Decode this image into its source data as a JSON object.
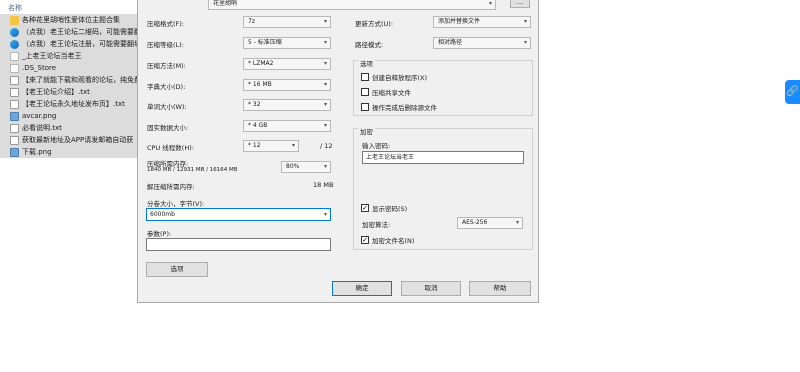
{
  "explorer": {
    "column_header": "名称",
    "items": [
      {
        "name": "各种花里胡哨性爱体位主题合集",
        "icon": "folder-icon",
        "selected": true
      },
      {
        "name": "（点我）老王论坛二维码，可能需要翻",
        "icon": "edge-icon",
        "selected": true
      },
      {
        "name": "（点我）老王论坛注册，可能需要翻墙",
        "icon": "edge-icon",
        "selected": true
      },
      {
        "name": "_上老王论坛当老王",
        "icon": "file-icon",
        "selected": true
      },
      {
        "name": ".DS_Store",
        "icon": "file-icon",
        "selected": true
      },
      {
        "name": "【来了就能下载和观看的论坛，纯免费",
        "icon": "text-file-icon",
        "selected": true
      },
      {
        "name": "【老王论坛介绍】.txt",
        "icon": "text-file-icon",
        "selected": true
      },
      {
        "name": "【老王论坛永久地址发布页】.txt",
        "icon": "text-file-icon",
        "selected": true
      },
      {
        "name": "avcar.png",
        "icon": "image-icon",
        "selected": true
      },
      {
        "name": "必看说明.txt",
        "icon": "text-file-icon",
        "selected": true
      },
      {
        "name": "获取最新地址及APP请发邮箱自动获",
        "icon": "text-file-icon",
        "selected": true
      },
      {
        "name": "下载.png",
        "icon": "image-icon",
        "selected": true
      }
    ]
  },
  "dialog": {
    "archive_path": "花里胡哨",
    "browse_label": "...",
    "format": {
      "label": "压缩格式(F):",
      "value": "7z"
    },
    "level": {
      "label": "压缩等级(L):",
      "value": "5 - 标准压缩"
    },
    "method": {
      "label": "压缩方法(M):",
      "value": "* LZMA2"
    },
    "dict": {
      "label": "字典大小(D):",
      "value": "* 16 MB"
    },
    "word": {
      "label": "单词大小(W):",
      "value": "* 32"
    },
    "solid": {
      "label": "固实数据大小:",
      "value": "* 4 GB"
    },
    "threads": {
      "label": "CPU 线程数(H):",
      "value": "* 12",
      "max": "/ 12"
    },
    "mem_compress": {
      "label": "压缩所需内存:",
      "detail": "1840 MB / 12931 MB / 16164 MB",
      "percent": "80%"
    },
    "mem_decompress": {
      "label": "解压缩所需内存:",
      "value": "18 MB"
    },
    "volume": {
      "label": "分卷大小，字节(V):",
      "value": "6000mb"
    },
    "params": {
      "label": "参数(P):",
      "value": ""
    },
    "options_button": "选项",
    "update_mode": {
      "label": "更新方式(U):",
      "value": "添加并替换文件"
    },
    "path_mode": {
      "label": "路径模式:",
      "value": "相对路径"
    },
    "options_group": {
      "title": "选项",
      "sfx": "创建自释放程序(X)",
      "shared": "压缩共享文件",
      "delete": "操作完成后删除源文件"
    },
    "encryption": {
      "title": "加密",
      "password_label": "输入密码:",
      "password": "上老王论坛当老王",
      "show_password": "显示密码(S)",
      "method_label": "加密算法:",
      "method": "AES-256",
      "encrypt_names": "加密文件名(N)"
    },
    "ok_button": "确定",
    "cancel_button": "取消",
    "help_button": "帮助"
  },
  "float_button_icon": "link-icon"
}
